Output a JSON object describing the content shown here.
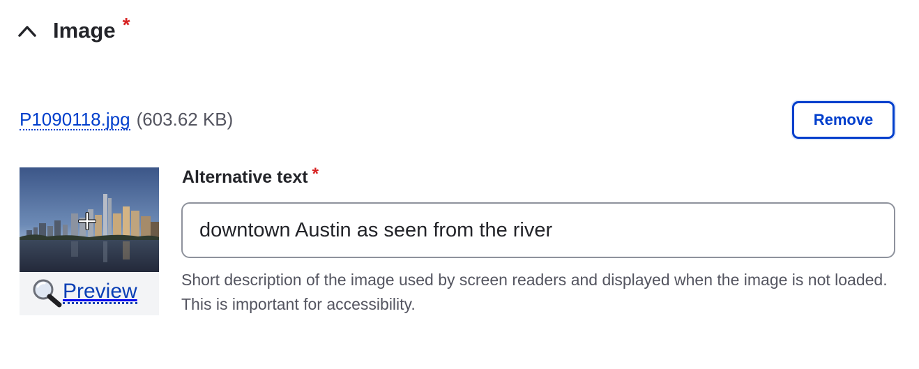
{
  "section": {
    "title": "Image",
    "required_marker": "*",
    "expanded": true
  },
  "file": {
    "name": "P1090118.jpg",
    "size": "(603.62 KB)",
    "remove_label": "Remove"
  },
  "thumbnail": {
    "preview_label": "Preview"
  },
  "alt_text": {
    "label": "Alternative text",
    "required_marker": "*",
    "value": "downtown Austin as seen from the river",
    "description": "Short description of the image used by screen readers and displayed when the image is not loaded. This is important for accessibility."
  },
  "colors": {
    "accent": "#003ecc",
    "required": "#d72222",
    "text": "#232429",
    "muted": "#545560"
  }
}
